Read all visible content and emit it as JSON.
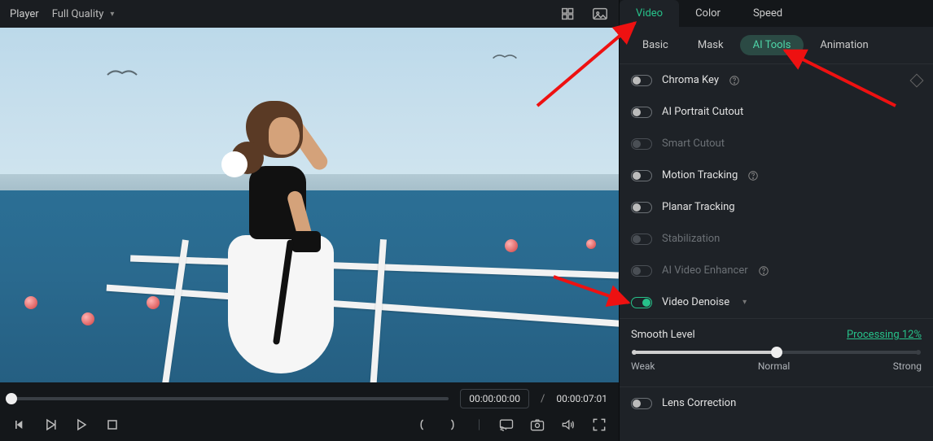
{
  "player": {
    "title": "Player",
    "quality_label": "Full Quality",
    "time_current": "00:00:00:00",
    "time_total": "00:00:07:01"
  },
  "inspector": {
    "top_tabs": {
      "video": "Video",
      "color": "Color",
      "speed": "Speed"
    },
    "sub_tabs": {
      "basic": "Basic",
      "mask": "Mask",
      "ai_tools": "AI Tools",
      "animation": "Animation"
    },
    "tools": {
      "chroma_key": "Chroma Key",
      "ai_portrait_cutout": "AI Portrait Cutout",
      "smart_cutout": "Smart Cutout",
      "motion_tracking": "Motion Tracking",
      "planar_tracking": "Planar Tracking",
      "stabilization": "Stabilization",
      "ai_video_enhancer": "AI Video Enhancer",
      "video_denoise": "Video Denoise",
      "lens_correction": "Lens Correction"
    },
    "smooth": {
      "label": "Smooth Level",
      "processing": "Processing 12%",
      "weak": "Weak",
      "normal": "Normal",
      "strong": "Strong"
    }
  }
}
